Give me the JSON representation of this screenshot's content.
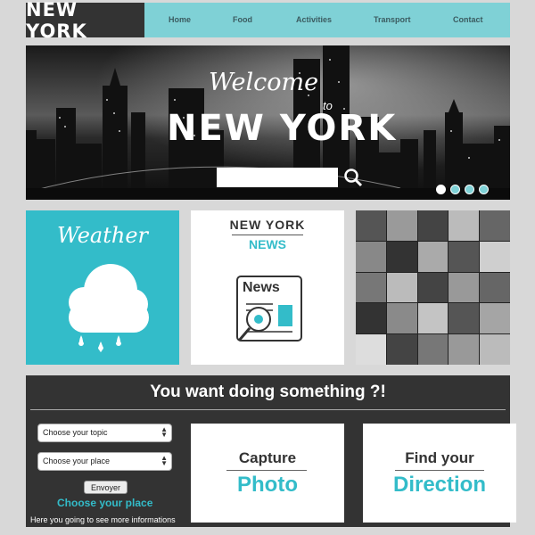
{
  "header": {
    "logo": "NEW YORK",
    "nav": [
      "Home",
      "Food",
      "Activities",
      "Transport",
      "Contact"
    ]
  },
  "hero": {
    "welcome": "Welcome",
    "to": "to",
    "title": "NEW YORK",
    "search_value": "",
    "slides": 4,
    "active_slide": 1
  },
  "panels": {
    "weather_title": "Weather",
    "news_brand": "NEW YORK",
    "news_sub": "NEWS",
    "news_icon_label": "News"
  },
  "activities": {
    "title": "You want doing something ?!",
    "topic_select": "Choose your topic",
    "place_select": "Choose your place",
    "send_label": "Envoyer",
    "choose_place_label": "Choose your place",
    "info": "Here you going to see more informations",
    "card_capture_top": "Capture",
    "card_capture_bottom": "Photo",
    "card_direction_top": "Find your",
    "card_direction_bottom": "Direction"
  },
  "colors": {
    "accent": "#33bcc9",
    "nav_bg": "#7fd1d6",
    "dark": "#333333"
  }
}
